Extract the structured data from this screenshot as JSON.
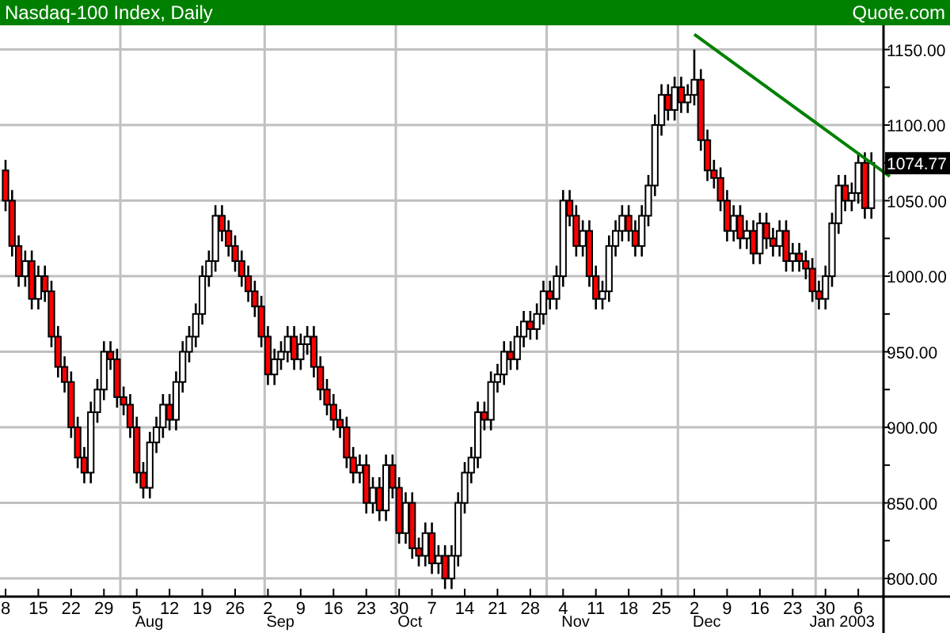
{
  "header": {
    "title": "Nasdaq-100 Index, Daily",
    "source": "Quote.com"
  },
  "chart": {
    "chart_data": {
      "type": "candlestick",
      "ylim": [
        788,
        1166
      ],
      "grid": true,
      "categories": [
        "8",
        null,
        null,
        null,
        null,
        "15",
        null,
        null,
        null,
        null,
        "22",
        null,
        null,
        null,
        null,
        "29",
        null,
        null,
        null,
        null,
        "5",
        null,
        null,
        null,
        null,
        "12",
        null,
        null,
        null,
        null,
        "19",
        null,
        null,
        null,
        null,
        "26",
        null,
        null,
        null,
        null,
        "2",
        null,
        null,
        null,
        null,
        "9",
        null,
        null,
        null,
        null,
        "16",
        null,
        null,
        null,
        null,
        "23",
        null,
        null,
        null,
        null,
        "30",
        null,
        null,
        null,
        null,
        "7",
        null,
        null,
        null,
        null,
        "14",
        null,
        null,
        null,
        null,
        "21",
        null,
        null,
        null,
        null,
        "28",
        null,
        null,
        null,
        null,
        "4",
        null,
        null,
        null,
        null,
        "11",
        null,
        null,
        null,
        null,
        "18",
        null,
        null,
        null,
        null,
        "25",
        null,
        null,
        null,
        null,
        "2",
        null,
        null,
        null,
        null,
        "9",
        null,
        null,
        null,
        null,
        "16",
        null,
        null,
        null,
        null,
        "23",
        null,
        null,
        null,
        null,
        "30",
        null,
        null,
        null,
        null,
        "6",
        null,
        null
      ],
      "ohlc": [
        [
          1070,
          1077,
          1043,
          1050
        ],
        [
          1050,
          1057,
          1013,
          1020
        ],
        [
          1020,
          1027,
          993,
          1000
        ],
        [
          1000,
          1017,
          993,
          1010
        ],
        [
          1010,
          1017,
          978,
          985
        ],
        [
          985,
          1007,
          978,
          1000
        ],
        [
          1000,
          1007,
          983,
          990
        ],
        [
          990,
          997,
          953,
          960
        ],
        [
          960,
          967,
          933,
          940
        ],
        [
          940,
          947,
          923,
          930
        ],
        [
          930,
          937,
          893,
          900
        ],
        [
          900,
          907,
          873,
          880
        ],
        [
          880,
          887,
          863,
          870
        ],
        [
          870,
          917,
          863,
          910
        ],
        [
          910,
          932,
          903,
          925
        ],
        [
          925,
          957,
          918,
          950
        ],
        [
          950,
          957,
          938,
          945
        ],
        [
          945,
          952,
          913,
          920
        ],
        [
          920,
          927,
          908,
          915
        ],
        [
          915,
          922,
          893,
          900
        ],
        [
          900,
          907,
          863,
          870
        ],
        [
          870,
          877,
          853,
          860
        ],
        [
          860,
          897,
          853,
          890
        ],
        [
          890,
          907,
          883,
          900
        ],
        [
          900,
          922,
          893,
          915
        ],
        [
          915,
          922,
          898,
          905
        ],
        [
          905,
          937,
          898,
          930
        ],
        [
          930,
          957,
          923,
          950
        ],
        [
          950,
          967,
          943,
          960
        ],
        [
          960,
          982,
          953,
          975
        ],
        [
          975,
          1007,
          968,
          1000
        ],
        [
          1000,
          1017,
          993,
          1010
        ],
        [
          1010,
          1047,
          1003,
          1040
        ],
        [
          1040,
          1047,
          1023,
          1030
        ],
        [
          1030,
          1037,
          1013,
          1020
        ],
        [
          1020,
          1027,
          1003,
          1010
        ],
        [
          1010,
          1017,
          993,
          1000
        ],
        [
          1000,
          1007,
          983,
          990
        ],
        [
          990,
          997,
          973,
          980
        ],
        [
          980,
          987,
          953,
          960
        ],
        [
          960,
          967,
          928,
          935
        ],
        [
          935,
          952,
          928,
          945
        ],
        [
          945,
          957,
          938,
          950
        ],
        [
          950,
          967,
          943,
          960
        ],
        [
          960,
          967,
          938,
          945
        ],
        [
          945,
          962,
          938,
          955
        ],
        [
          955,
          967,
          948,
          960
        ],
        [
          960,
          967,
          933,
          940
        ],
        [
          940,
          947,
          918,
          925
        ],
        [
          925,
          932,
          908,
          915
        ],
        [
          915,
          922,
          898,
          905
        ],
        [
          905,
          912,
          893,
          900
        ],
        [
          900,
          907,
          873,
          880
        ],
        [
          880,
          887,
          863,
          870
        ],
        [
          870,
          882,
          863,
          875
        ],
        [
          875,
          882,
          843,
          850
        ],
        [
          850,
          867,
          843,
          860
        ],
        [
          860,
          867,
          838,
          845
        ],
        [
          845,
          882,
          838,
          875
        ],
        [
          875,
          882,
          853,
          860
        ],
        [
          860,
          867,
          823,
          830
        ],
        [
          830,
          857,
          823,
          850
        ],
        [
          850,
          857,
          813,
          820
        ],
        [
          820,
          827,
          808,
          815
        ],
        [
          815,
          837,
          808,
          830
        ],
        [
          830,
          837,
          803,
          810
        ],
        [
          810,
          822,
          803,
          815
        ],
        [
          815,
          822,
          793,
          800
        ],
        [
          800,
          822,
          793,
          815
        ],
        [
          815,
          857,
          808,
          850
        ],
        [
          850,
          877,
          843,
          870
        ],
        [
          870,
          887,
          863,
          880
        ],
        [
          880,
          917,
          873,
          910
        ],
        [
          910,
          917,
          898,
          905
        ],
        [
          905,
          937,
          898,
          930
        ],
        [
          930,
          942,
          923,
          935
        ],
        [
          935,
          957,
          928,
          950
        ],
        [
          950,
          957,
          938,
          945
        ],
        [
          945,
          967,
          938,
          960
        ],
        [
          960,
          977,
          953,
          970
        ],
        [
          970,
          977,
          958,
          965
        ],
        [
          965,
          982,
          958,
          975
        ],
        [
          975,
          997,
          968,
          990
        ],
        [
          990,
          997,
          978,
          985
        ],
        [
          985,
          1007,
          978,
          1000
        ],
        [
          1000,
          1057,
          993,
          1050
        ],
        [
          1050,
          1057,
          1033,
          1040
        ],
        [
          1040,
          1047,
          1013,
          1020
        ],
        [
          1020,
          1037,
          1013,
          1030
        ],
        [
          1030,
          1037,
          993,
          1000
        ],
        [
          1000,
          1007,
          978,
          985
        ],
        [
          985,
          997,
          978,
          990
        ],
        [
          990,
          1027,
          983,
          1020
        ],
        [
          1020,
          1037,
          1013,
          1030
        ],
        [
          1030,
          1047,
          1023,
          1040
        ],
        [
          1040,
          1047,
          1023,
          1030
        ],
        [
          1030,
          1037,
          1013,
          1020
        ],
        [
          1020,
          1047,
          1013,
          1040
        ],
        [
          1040,
          1067,
          1033,
          1060
        ],
        [
          1060,
          1107,
          1053,
          1100
        ],
        [
          1100,
          1127,
          1093,
          1120
        ],
        [
          1120,
          1127,
          1103,
          1110
        ],
        [
          1110,
          1132,
          1103,
          1125
        ],
        [
          1125,
          1132,
          1108,
          1115
        ],
        [
          1115,
          1127,
          1108,
          1120
        ],
        [
          1120,
          1150,
          1113,
          1130
        ],
        [
          1130,
          1137,
          1083,
          1090
        ],
        [
          1090,
          1097,
          1063,
          1070
        ],
        [
          1070,
          1077,
          1058,
          1065
        ],
        [
          1065,
          1072,
          1043,
          1050
        ],
        [
          1050,
          1057,
          1023,
          1030
        ],
        [
          1030,
          1047,
          1023,
          1040
        ],
        [
          1040,
          1047,
          1018,
          1025
        ],
        [
          1025,
          1037,
          1018,
          1030
        ],
        [
          1030,
          1037,
          1008,
          1015
        ],
        [
          1015,
          1042,
          1008,
          1035
        ],
        [
          1035,
          1042,
          1018,
          1025
        ],
        [
          1025,
          1032,
          1013,
          1020
        ],
        [
          1020,
          1037,
          1013,
          1030
        ],
        [
          1030,
          1037,
          1003,
          1010
        ],
        [
          1010,
          1022,
          1003,
          1015
        ],
        [
          1015,
          1022,
          1003,
          1010
        ],
        [
          1010,
          1017,
          998,
          1005
        ],
        [
          1005,
          1012,
          983,
          990
        ],
        [
          990,
          997,
          978,
          985
        ],
        [
          985,
          1007,
          978,
          1000
        ],
        [
          1000,
          1042,
          993,
          1035
        ],
        [
          1035,
          1067,
          1028,
          1060
        ],
        [
          1060,
          1067,
          1043,
          1050
        ],
        [
          1050,
          1062,
          1043,
          1055
        ],
        [
          1055,
          1082,
          1048,
          1075
        ],
        [
          1075,
          1082,
          1038,
          1045
        ],
        [
          1045,
          1082,
          1038,
          1075
        ]
      ],
      "yticks": [
        {
          "value": 1150,
          "label": "1150.00"
        },
        {
          "value": 1100,
          "label": "1100.00"
        },
        {
          "value": 1050,
          "label": "1050.00"
        },
        {
          "value": 1000,
          "label": "1000.00"
        },
        {
          "value": 950,
          "label": "950.00"
        },
        {
          "value": 900,
          "label": "900.00"
        },
        {
          "value": 850,
          "label": "850.00"
        },
        {
          "value": 800,
          "label": "800.00"
        }
      ]
    },
    "month_labels": [
      "Aug",
      "Sep",
      "Oct",
      "Nov",
      "Dec",
      "Jan 2003"
    ],
    "last_price": {
      "label": "1074.77"
    }
  }
}
